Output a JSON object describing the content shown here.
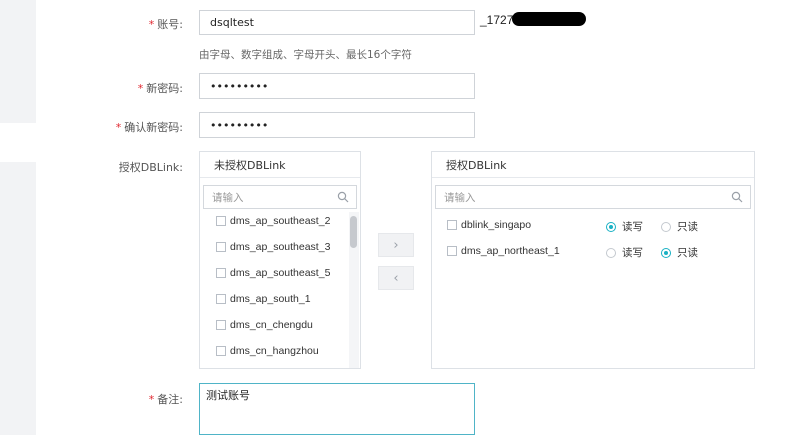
{
  "form": {
    "account": {
      "label": "账号:",
      "value": "dsqltest",
      "suffix": "_17277",
      "hint": "由字母、数字组成、字母开头、最长16个字符"
    },
    "new_password": {
      "label": "新密码:",
      "value": "•••••••••"
    },
    "confirm_password": {
      "label": "确认新密码:",
      "value": "•••••••••"
    },
    "authorize": {
      "label": "授权DBLink:"
    },
    "remark": {
      "label": "备注:",
      "value": "测试账号"
    }
  },
  "unauthorized": {
    "title": "未授权DBLink",
    "search_placeholder": "请输入",
    "items": [
      "dms_ap_southeast_2",
      "dms_ap_southeast_3",
      "dms_ap_southeast_5",
      "dms_ap_south_1",
      "dms_cn_chengdu",
      "dms_cn_hangzhou"
    ]
  },
  "authorized": {
    "title": "授权DBLink",
    "search_placeholder": "请输入",
    "items": [
      {
        "name": "dblink_singapo",
        "option_rw": "读写",
        "option_ro": "只读",
        "selected": "rw"
      },
      {
        "name": "dms_ap_northeast_1",
        "option_rw": "读写",
        "option_ro": "只读",
        "selected": "ro"
      }
    ]
  },
  "transfer": {
    "right_arrow": "›",
    "left_arrow": "‹"
  },
  "colors": {
    "accent": "#19b1c4",
    "required": "#e0262f"
  }
}
